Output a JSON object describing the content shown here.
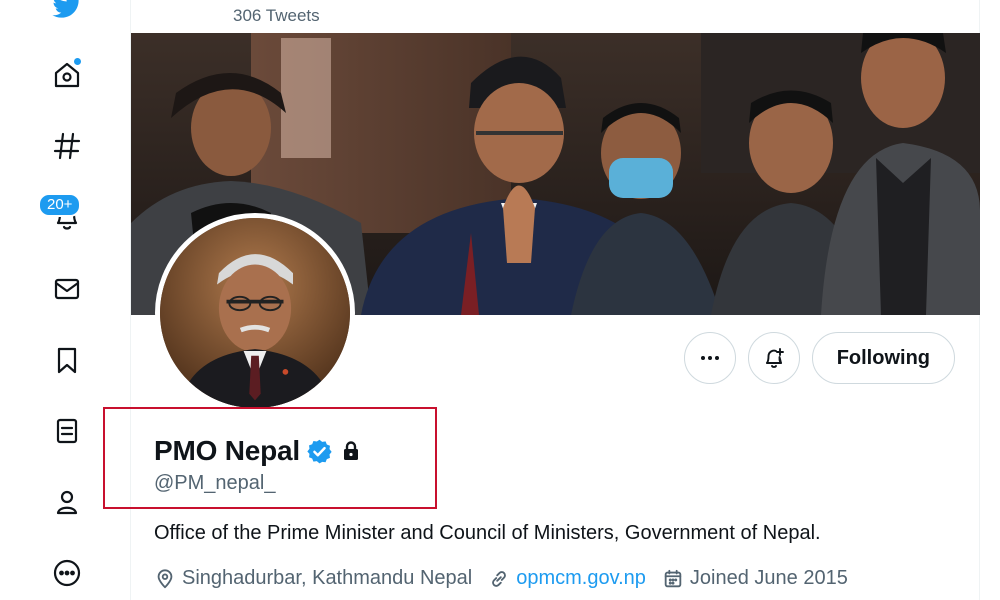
{
  "header": {
    "tweet_count": "306 Tweets"
  },
  "nav": {
    "items": [
      {
        "name": "twitter-logo-icon"
      },
      {
        "name": "home-icon"
      },
      {
        "name": "explore-hashtag-icon"
      },
      {
        "name": "notifications-bell-icon",
        "badge": "20+"
      },
      {
        "name": "messages-envelope-icon"
      },
      {
        "name": "bookmarks-icon"
      },
      {
        "name": "lists-icon"
      },
      {
        "name": "profile-person-icon"
      },
      {
        "name": "more-circle-icon"
      }
    ]
  },
  "profile": {
    "name": "PMO Nepal",
    "handle": "@PM_nepal_",
    "bio": "Office of the Prime Minister and Council of Ministers, Government of Nepal.",
    "location": "Singhadurbar, Kathmandu Nepal",
    "website": "opmcm.gov.np",
    "joined": "Joined June 2015"
  },
  "actions": {
    "following_label": "Following"
  },
  "colors": {
    "accent": "#1d9bf0",
    "text": "#0f1419",
    "secondary": "#536471",
    "highlight_box": "#c8102e"
  }
}
